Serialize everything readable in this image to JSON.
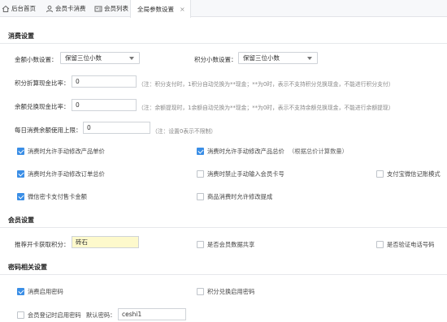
{
  "tabs": [
    {
      "label": "后台首页",
      "icon": "home-icon"
    },
    {
      "label": "会员卡消费",
      "icon": "user-icon"
    },
    {
      "label": "会员列表",
      "icon": "id-card-icon"
    },
    {
      "label": "全局参数设置",
      "icon": "",
      "active": true,
      "close": "×"
    }
  ],
  "consume": {
    "title": "消费设置",
    "amount_decimal_label": "金额小数设置：",
    "amount_decimal_value": "保留三位小数",
    "points_decimal_label": "积分小数设置：",
    "points_decimal_value": "保留三位小数",
    "points_rate_label": "积分折算现金比率：",
    "points_rate_value": "0",
    "points_rate_note": "（注：积分支付时，1积分自动兑换为**现金；**为0时，表示不支持积分兑换现金，不能进行积分支付）",
    "balance_rate_label": "余额兑换现金比率：",
    "balance_rate_value": "0",
    "balance_rate_note": "（注：余额提现时，1余额自动兑换为**现金；**为0时，表示不支持余额兑换现金，不能进行余额提现）",
    "daily_limit_label": "每日消费余额使用上限：",
    "daily_limit_value": "0",
    "daily_limit_note": "（注：设置0表示不限制）",
    "options": {
      "allow_edit_price": "消费时允许手动修改产品单价",
      "allow_edit_total": "消费时允许手动修改产品总价",
      "allow_edit_total_note": "（根据总价计算数量）",
      "allow_edit_order_total": "消费时允许手动修改订单总价",
      "forbid_manual_card": "消费时禁止手动输入会员卡号",
      "alipay_wechat_mode": "支付宝微信记账模式",
      "wechat_card_balance": "微信密卡支付售卡金额",
      "allow_edit_commission": "商品消费时允许修改提成"
    }
  },
  "member": {
    "title": "会员设置",
    "referral_points_label": "推荐开卡获取积分：",
    "referral_points_value": "砖石",
    "share_data": "是否会员数据共享",
    "verify_phone": "是否验证电话号码"
  },
  "password": {
    "title": "密码相关设置",
    "consume_password": "消费启用密码",
    "points_password": "积分兑换启用密码",
    "register_password": "会员登记时启用密码",
    "default_password_label": "默认密码：",
    "default_password_value": "ceshi1"
  },
  "colors": {
    "accent": "#3a8ee6",
    "highlight_input": "#fdf9cc"
  }
}
